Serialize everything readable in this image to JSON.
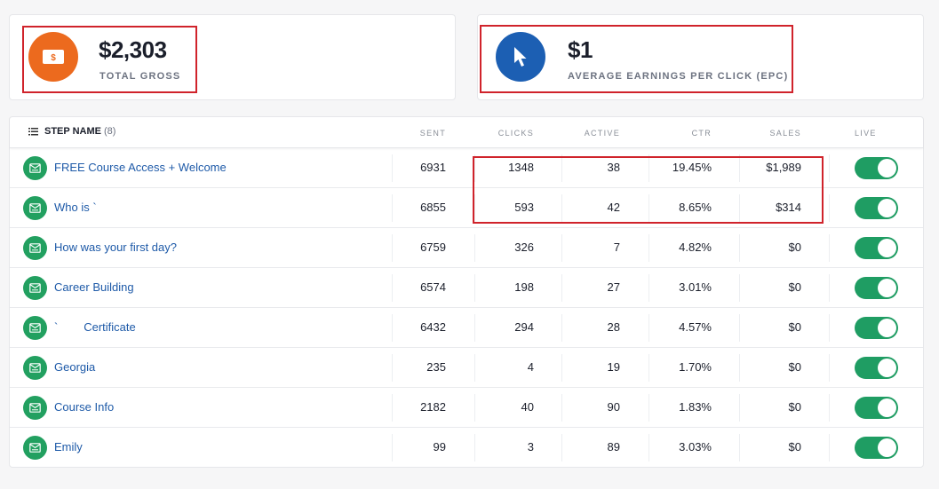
{
  "stats": {
    "total_gross": {
      "value": "$2,303",
      "label": "TOTAL GROSS",
      "icon": "money-bill-icon",
      "color": "#ec6a1e"
    },
    "epc": {
      "value": "$1",
      "label": "AVERAGE EARNINGS PER CLICK (EPC)",
      "icon": "cursor-pointer-icon",
      "color": "#1c5fb3"
    }
  },
  "table": {
    "step_header": "STEP NAME",
    "step_count": "(8)",
    "columns": [
      "SENT",
      "CLICKS",
      "ACTIVE",
      "CTR",
      "SALES",
      "LIVE"
    ],
    "rows": [
      {
        "name": "FREE Course Access + Welcome",
        "sent": "6931",
        "clicks": "1348",
        "active": "38",
        "ctr": "19.45%",
        "sales": "$1,989",
        "live": true
      },
      {
        "name": "Who is `",
        "sent": "6855",
        "clicks": "593",
        "active": "42",
        "ctr": "8.65%",
        "sales": "$314",
        "live": true
      },
      {
        "name": "How was your first day?",
        "sent": "6759",
        "clicks": "326",
        "active": "7",
        "ctr": "4.82%",
        "sales": "$0",
        "live": true
      },
      {
        "name": "Career Building",
        "sent": "6574",
        "clicks": "198",
        "active": "27",
        "ctr": "3.01%",
        "sales": "$0",
        "live": true
      },
      {
        "name": "`        Certificate",
        "sent": "6432",
        "clicks": "294",
        "active": "28",
        "ctr": "4.57%",
        "sales": "$0",
        "live": true
      },
      {
        "name": "Georgia",
        "sent": "235",
        "clicks": "4",
        "active": "19",
        "ctr": "1.70%",
        "sales": "$0",
        "live": true
      },
      {
        "name": "Course Info",
        "sent": "2182",
        "clicks": "40",
        "active": "90",
        "ctr": "1.83%",
        "sales": "$0",
        "live": true
      },
      {
        "name": "Emily",
        "sent": "99",
        "clicks": "3",
        "active": "89",
        "ctr": "3.03%",
        "sales": "$0",
        "live": true
      }
    ]
  },
  "colors": {
    "highlight": "#d0232b",
    "link": "#1e5aa8",
    "step_icon": "#22a060",
    "toggle_on": "#1f9d63"
  }
}
